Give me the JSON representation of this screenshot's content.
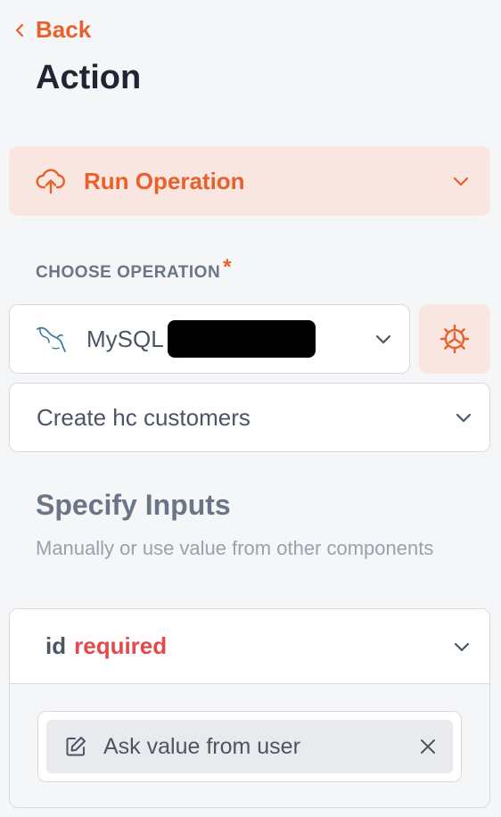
{
  "nav": {
    "back_label": "Back"
  },
  "page": {
    "title": "Action"
  },
  "action_type": {
    "label": "Run Operation"
  },
  "operation": {
    "section_label": "CHOOSE OPERATION",
    "required_marker": "*",
    "datasource_name": "MySQL",
    "query_name": "Create hc customers"
  },
  "inputs": {
    "title": "Specify Inputs",
    "subtitle": "Manually or use value from other components",
    "params": [
      {
        "name": "id",
        "required_label": "required",
        "mode_label": "Ask value from user"
      }
    ]
  },
  "colors": {
    "accent": "#e8602c",
    "accent_bg": "#f9e6e0",
    "required": "#e5484d",
    "mysql": "#3e7d9e"
  }
}
